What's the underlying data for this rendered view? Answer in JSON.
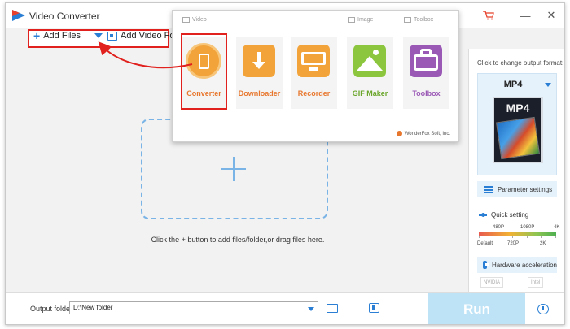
{
  "window": {
    "title": "Video Converter"
  },
  "toolbar": {
    "add_files": "Add Files",
    "add_folder": "Add Video Folder"
  },
  "main": {
    "hint": "Click the + button to add files/folder,or drag files here."
  },
  "popup": {
    "tabs": {
      "video": "Video",
      "image": "Image",
      "toolbox": "Toolbox"
    },
    "tiles": [
      {
        "label": "Converter",
        "icon": "film-reel-icon",
        "color": "#f2a33a"
      },
      {
        "label": "Downloader",
        "icon": "download-icon",
        "color": "#f2a33a"
      },
      {
        "label": "Recorder",
        "icon": "monitor-icon",
        "color": "#f2a33a"
      },
      {
        "label": "GIF Maker",
        "icon": "image-icon",
        "color": "#8cc63f"
      },
      {
        "label": "Toolbox",
        "icon": "toolbox-icon",
        "color": "#9b59b6"
      }
    ],
    "brand": "WonderFox Soft, Inc."
  },
  "right_panel": {
    "caption": "Click to change output format:",
    "format": "MP4",
    "format_art_label": "MP4",
    "parameter_settings": "Parameter settings",
    "quick_setting": "Quick setting",
    "quality_top": [
      "480P",
      "1080P",
      "4K"
    ],
    "quality_bottom": [
      "Default",
      "720P",
      "2K"
    ],
    "hardware_acceleration": "Hardware acceleration",
    "vendors": [
      "NVIDIA",
      "Intel"
    ]
  },
  "bottom": {
    "output_label": "Output folder:",
    "output_value": "D:\\New folder",
    "run": "Run"
  },
  "colors": {
    "accent": "#2a7fd4",
    "highlight": "#e0211e",
    "run": "#bfe3f6"
  }
}
